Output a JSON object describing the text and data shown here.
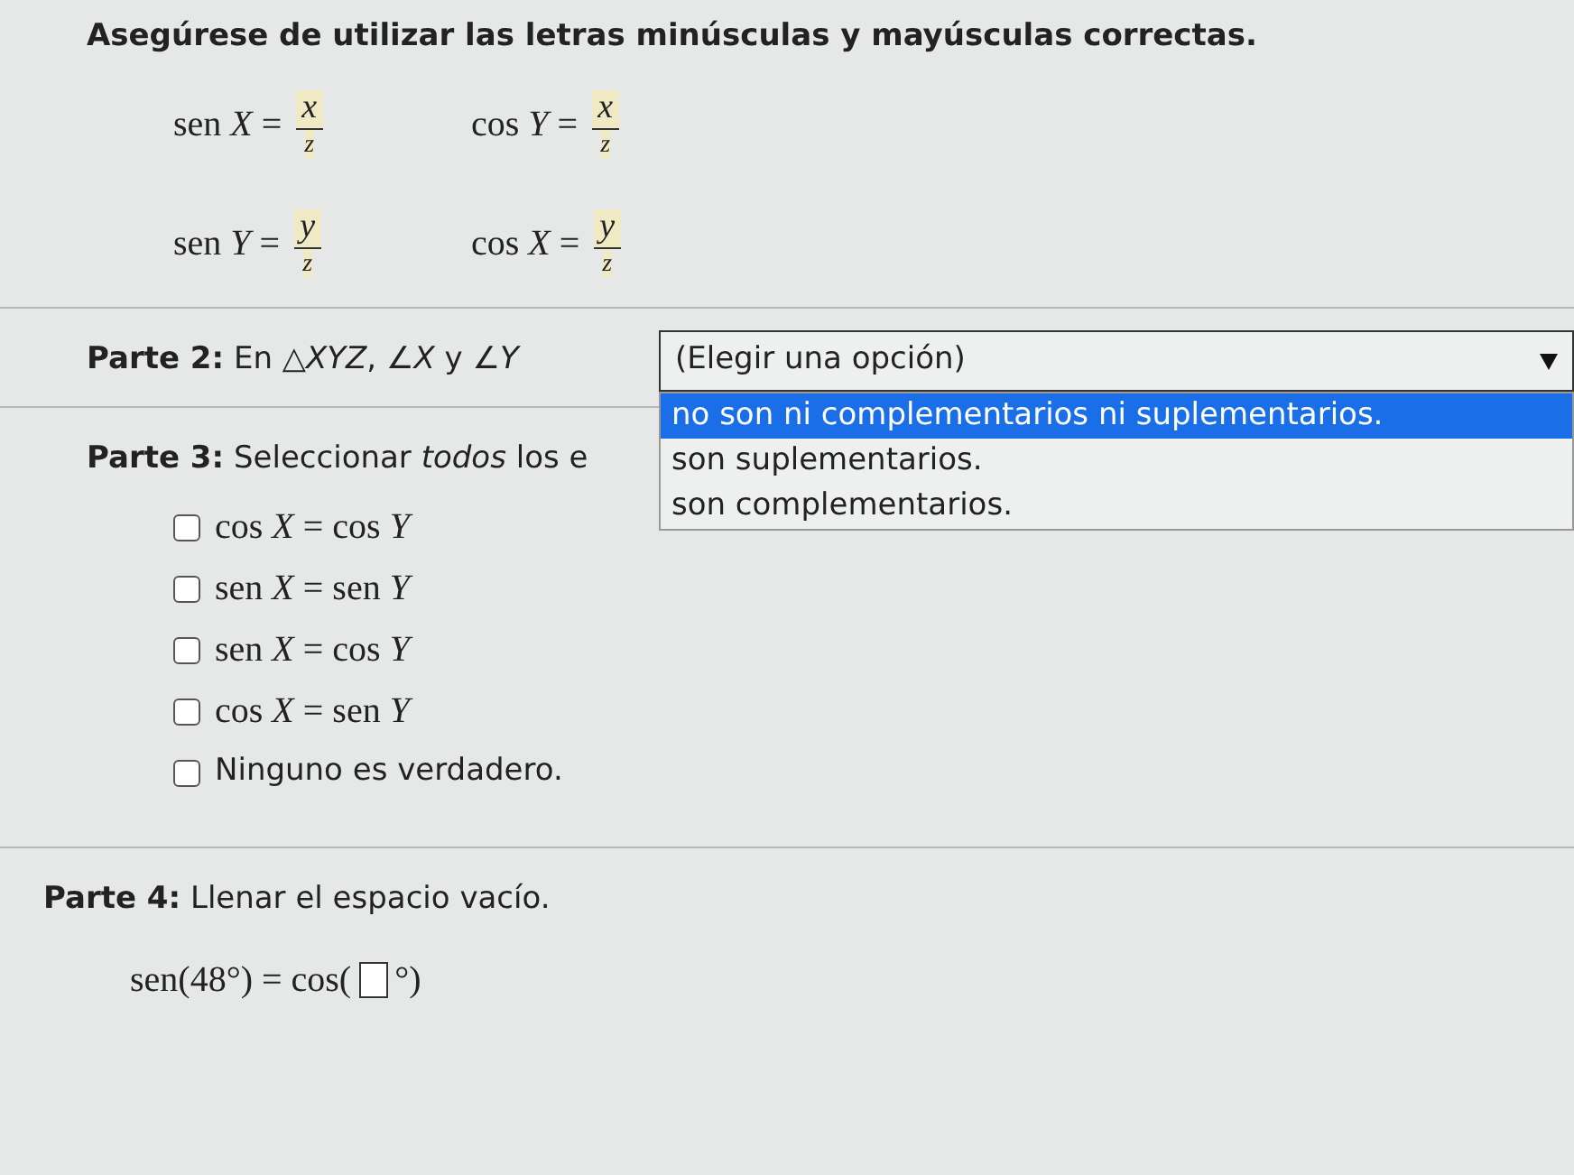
{
  "instruction": "Asegúrese de utilizar las letras minúsculas y mayúsculas correctas.",
  "fractions": [
    {
      "lhs": "sen *X* =",
      "num": "*x*",
      "den": "*z*"
    },
    {
      "lhs": "cos *Y* =",
      "num": "*x*",
      "den": "*z*"
    },
    {
      "lhs": "sen *Y* =",
      "num": "*y*",
      "den": "*z*"
    },
    {
      "lhs": "cos *X* =",
      "num": "*y*",
      "den": "*z*"
    }
  ],
  "part2": {
    "text": "**Parte 2:** En △*XYZ*, ∠*X* y ∠*Y*",
    "dropdown": {
      "value": "(Elegir una opción)",
      "expanded": true,
      "options": [
        {
          "label": "no son ni complementarios ni suplementarios.",
          "selected": true
        },
        {
          "label": "son suplementarios.",
          "selected": false
        },
        {
          "label": "son complementarios.",
          "selected": false
        }
      ]
    }
  },
  "part3": {
    "text": "**Parte 3:** Seleccionar *todos* los e",
    "choices": [
      {
        "label": "cos *X* = cos *Y*",
        "kind": "math",
        "checked": false
      },
      {
        "label": "sen *X* = sen *Y*",
        "kind": "math",
        "checked": false
      },
      {
        "label": "sen *X* = cos *Y*",
        "kind": "math",
        "checked": false
      },
      {
        "label": "cos *X* = sen *Y*",
        "kind": "math",
        "checked": false
      },
      {
        "label": "Ninguno es verdadero.",
        "kind": "text",
        "checked": false
      }
    ]
  },
  "part4": {
    "text": "**Parte 4:** Llenar el espacio vacío.",
    "before": "sen(48°) = cos(",
    "after": "°)"
  }
}
